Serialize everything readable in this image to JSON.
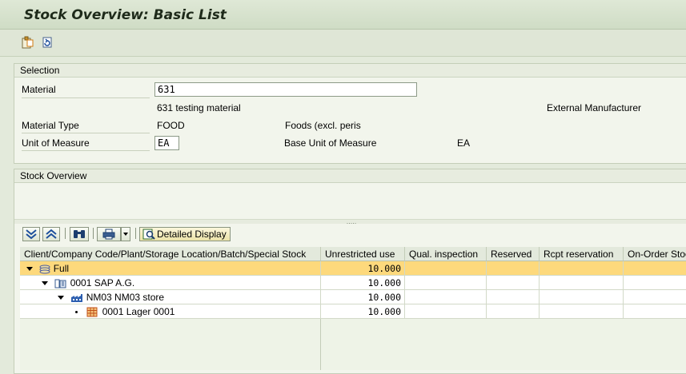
{
  "window": {
    "title": "Stock Overview: Basic List"
  },
  "toolbar": {
    "icons": [
      "clipboard-icon",
      "refresh-icon"
    ]
  },
  "selection": {
    "title": "Selection",
    "material_label": "Material",
    "material_value": "631",
    "material_description": "631 testing material",
    "external_manufacturer_label": "External Manufacturer",
    "material_type_label": "Material Type",
    "material_type_value": "FOOD",
    "material_type_description": "Foods (excl. peris",
    "uom_label": "Unit of Measure",
    "uom_value": "EA",
    "base_uom_label": "Base Unit of Measure",
    "base_uom_value": "EA"
  },
  "overview": {
    "title": "Stock Overview",
    "splitter_dots": "....."
  },
  "grid_toolbar": {
    "detailed_display_label": "Detailed Display"
  },
  "table": {
    "columns": [
      "Client/Company Code/Plant/Storage Location/Batch/Special Stock",
      "Unrestricted use",
      "Qual. inspection",
      "Reserved",
      "Rcpt reservation",
      "On-Order Stock"
    ],
    "rows": [
      {
        "label": "Full",
        "unrestricted": "10.000",
        "icon": "stack-icon",
        "expander": "expanded",
        "highlighted": true
      },
      {
        "label": "0001 SAP A.G.",
        "unrestricted": "10.000",
        "icon": "company-icon",
        "expander": "expanded",
        "highlighted": false
      },
      {
        "label": "NM03 NM03 store",
        "unrestricted": "10.000",
        "icon": "plant-icon",
        "expander": "expanded",
        "highlighted": false
      },
      {
        "label": "0001 Lager 0001",
        "unrestricted": "10.000",
        "icon": "storage-location-icon",
        "expander": "leaf",
        "highlighted": false
      }
    ]
  },
  "colors": {
    "highlight_row": "#fdd97c",
    "frame_bg": "#e3eadb",
    "panel_bg": "#f2f5ec"
  }
}
